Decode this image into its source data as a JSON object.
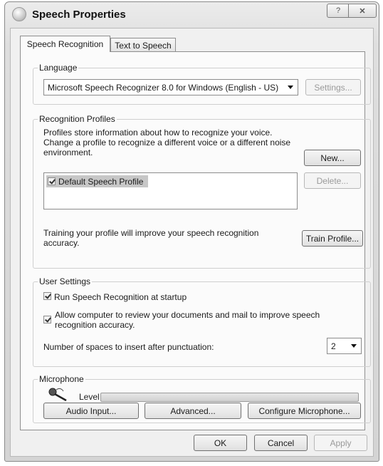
{
  "window": {
    "title": "Speech Properties",
    "help_glyph": "?",
    "close_glyph": "✕"
  },
  "tabs": [
    {
      "label": "Speech Recognition",
      "active": true
    },
    {
      "label": "Text to Speech",
      "active": false
    }
  ],
  "language": {
    "group_label": "Language",
    "selected": "Microsoft Speech Recognizer 8.0 for Windows (English - US)",
    "settings_button": "Settings..."
  },
  "profiles": {
    "group_label": "Recognition Profiles",
    "description_line1": "Profiles store information about how to recognize your voice.",
    "description_line2": "Change a profile to recognize a different voice or a different noise",
    "description_line3": "environment.",
    "new_button": "New...",
    "delete_button": "Delete...",
    "items": [
      {
        "label": "Default Speech Profile",
        "checked": true,
        "selected": true
      }
    ],
    "training_line1": "Training your profile will improve your speech recognition",
    "training_line2": "accuracy.",
    "train_button": "Train Profile..."
  },
  "user_settings": {
    "group_label": "User Settings",
    "startup_label": "Run Speech Recognition at startup",
    "startup_checked": true,
    "review_line1": "Allow computer to review your documents and mail to improve speech",
    "review_line2": "recognition accuracy.",
    "review_checked": true,
    "spaces_label": "Number of spaces to insert after punctuation:",
    "spaces_value": "2"
  },
  "microphone": {
    "group_label": "Microphone",
    "icon": "microphone-icon",
    "level_label": "Level",
    "level_fraction": 0,
    "audio_input_button": "Audio Input...",
    "advanced_button": "Advanced...",
    "configure_button": "Configure Microphone..."
  },
  "footer": {
    "ok_button": "OK",
    "cancel_button": "Cancel",
    "apply_button": "Apply"
  },
  "colors": {
    "selection": "#c7c7c7",
    "disabled_text": "#9a9a9a"
  }
}
